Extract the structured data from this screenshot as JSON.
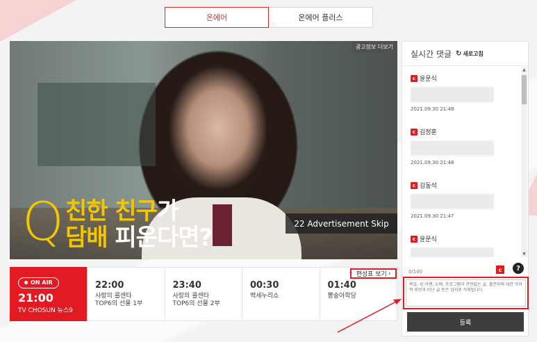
{
  "tabs": [
    {
      "label": "온에어",
      "active": true
    },
    {
      "label": "온에어 플러스",
      "active": false
    }
  ],
  "video": {
    "ad_info_label": "광고정보 더보기",
    "caption": {
      "q": "Q",
      "line1_yellow": "친한 친구",
      "line1_white": "가",
      "line2_yellow": "담배",
      "line2_white": " 피운다면?"
    },
    "skip_label": "22 Advertisement Skip"
  },
  "schedule": {
    "onair": {
      "badge": "ON AIR",
      "time": "21:00",
      "program": "TV CHOSUN 뉴스9"
    },
    "timetable_label": "편성표 보기",
    "slots": [
      {
        "time": "22:00",
        "title_l1": "사랑의 콜센타",
        "title_l2": "TOP6의 선물 1부"
      },
      {
        "time": "23:40",
        "title_l1": "사랑의 콜센타",
        "title_l2": "TOP6의 선물 2부"
      },
      {
        "time": "00:30",
        "title_l1": "백세누리쇼",
        "title_l2": ""
      },
      {
        "time": "01:40",
        "title_l1": "뽕숭아학당",
        "title_l2": ""
      }
    ]
  },
  "comments_panel": {
    "title": "실시간 댓글",
    "refresh_label": "새로고침",
    "comments": [
      {
        "name": "윤문식",
        "date": "2021.09.30 21:48"
      },
      {
        "name": "김정훈",
        "date": "2021.09.30 21:48"
      },
      {
        "name": "김동석",
        "date": "2021.09.30 21:47"
      },
      {
        "name": "윤문식",
        "date": ""
      }
    ],
    "counter": "0/100",
    "placeholder": "욕설, 성 이벤, 도배, 프로그램과 관련없는 글, 출연자에 대한 악의적 비방과 비난 글 등은 임의로 삭제됩니다.",
    "submit_label": "등록"
  },
  "colors": {
    "accent": "#e21b23",
    "caption_yellow": "#f4c600"
  }
}
